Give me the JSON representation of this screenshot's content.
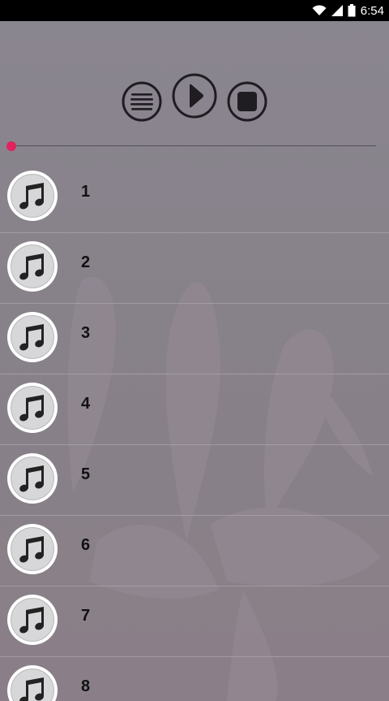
{
  "status_bar": {
    "time": "6:54",
    "icons": [
      "wifi-icon",
      "signal-icon",
      "battery-icon"
    ]
  },
  "controls": {
    "icons": [
      "playlist-icon",
      "play-icon",
      "stop-icon"
    ]
  },
  "seek": {
    "progress": 0
  },
  "tracks": [
    {
      "label": "1",
      "icon": "music-note-icon"
    },
    {
      "label": "2",
      "icon": "music-note-icon"
    },
    {
      "label": "3",
      "icon": "music-note-icon"
    },
    {
      "label": "4",
      "icon": "music-note-icon"
    },
    {
      "label": "5",
      "icon": "music-note-icon"
    },
    {
      "label": "6",
      "icon": "music-note-icon"
    },
    {
      "label": "7",
      "icon": "music-note-icon"
    },
    {
      "label": "8",
      "icon": "music-note-icon"
    }
  ],
  "colors": {
    "accent": "#e0245f",
    "background": "#8a8690",
    "status_bar": "#000000"
  }
}
